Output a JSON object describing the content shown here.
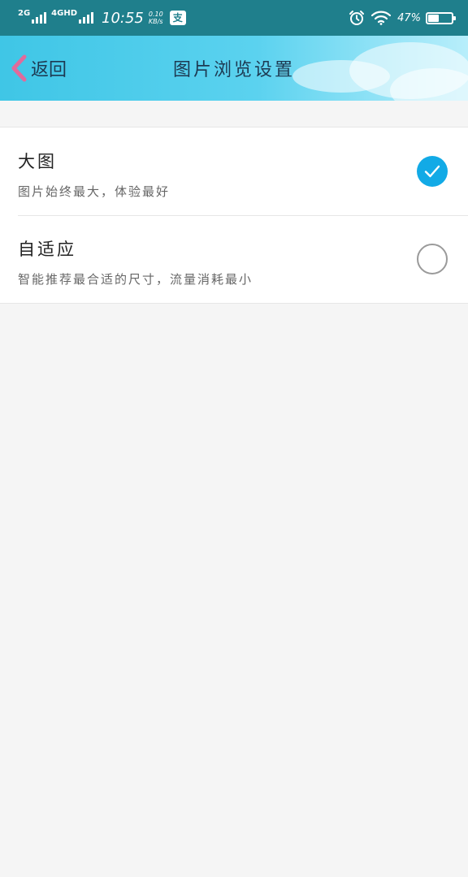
{
  "status_bar": {
    "network_2g": "2G",
    "network_4g": "4GHD",
    "time": "10:55",
    "speed_value": "0.10",
    "speed_unit": "KB/s",
    "app_badge": "支",
    "battery_percent": "47%",
    "battery_level": 0.47
  },
  "header": {
    "back_label": "返回",
    "title": "图片浏览设置"
  },
  "options": [
    {
      "title": "大图",
      "description": "图片始终最大，体验最好",
      "selected": true
    },
    {
      "title": "自适应",
      "description": "智能推荐最合适的尺寸，流量消耗最小",
      "selected": false
    }
  ],
  "colors": {
    "status_bar": "#1f7f8c",
    "header_gradient_start": "#3fc6e6",
    "selected_check": "#12aae6",
    "back_arrow": "#e06b9b",
    "background": "#f5f5f5"
  }
}
